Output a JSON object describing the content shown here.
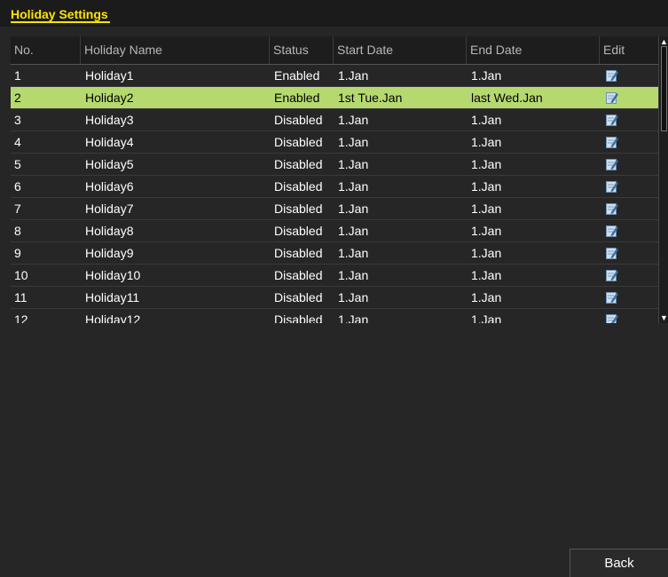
{
  "window": {
    "title": "Holiday Settings"
  },
  "table": {
    "columns": [
      "No.",
      "Holiday Name",
      "Status",
      "Start Date",
      "End Date",
      "Edit"
    ],
    "rows": [
      {
        "no": "1",
        "name": "Holiday1",
        "status": "Enabled",
        "start": "1.Jan",
        "end": "1.Jan",
        "selected": false
      },
      {
        "no": "2",
        "name": "Holiday2",
        "status": "Enabled",
        "start": "1st Tue.Jan",
        "end": "last Wed.Jan",
        "selected": true
      },
      {
        "no": "3",
        "name": "Holiday3",
        "status": "Disabled",
        "start": "1.Jan",
        "end": "1.Jan",
        "selected": false
      },
      {
        "no": "4",
        "name": "Holiday4",
        "status": "Disabled",
        "start": "1.Jan",
        "end": "1.Jan",
        "selected": false
      },
      {
        "no": "5",
        "name": "Holiday5",
        "status": "Disabled",
        "start": "1.Jan",
        "end": "1.Jan",
        "selected": false
      },
      {
        "no": "6",
        "name": "Holiday6",
        "status": "Disabled",
        "start": "1.Jan",
        "end": "1.Jan",
        "selected": false
      },
      {
        "no": "7",
        "name": "Holiday7",
        "status": "Disabled",
        "start": "1.Jan",
        "end": "1.Jan",
        "selected": false
      },
      {
        "no": "8",
        "name": "Holiday8",
        "status": "Disabled",
        "start": "1.Jan",
        "end": "1.Jan",
        "selected": false
      },
      {
        "no": "9",
        "name": "Holiday9",
        "status": "Disabled",
        "start": "1.Jan",
        "end": "1.Jan",
        "selected": false
      },
      {
        "no": "10",
        "name": "Holiday10",
        "status": "Disabled",
        "start": "1.Jan",
        "end": "1.Jan",
        "selected": false
      },
      {
        "no": "11",
        "name": "Holiday11",
        "status": "Disabled",
        "start": "1.Jan",
        "end": "1.Jan",
        "selected": false
      },
      {
        "no": "12",
        "name": "Holiday12",
        "status": "Disabled",
        "start": "1.Jan",
        "end": "1.Jan",
        "selected": false
      }
    ],
    "edit_icon": "edit-icon"
  },
  "scroll": {
    "up_icon": "chevron-up-icon",
    "down_icon": "chevron-down-icon"
  },
  "buttons": {
    "back_label": "Back"
  },
  "colors": {
    "accent": "#ffe400",
    "selected_row": "#b6d96f",
    "background": "#262626"
  }
}
